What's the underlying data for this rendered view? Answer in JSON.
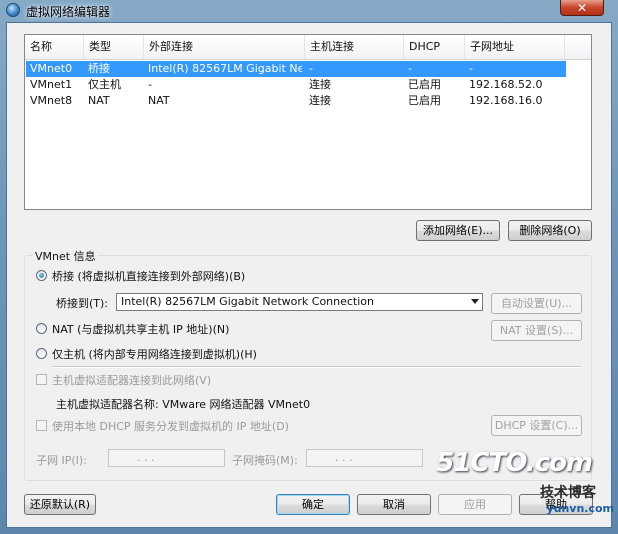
{
  "window": {
    "title": "虚拟网络编辑器",
    "close_glyph": "✕"
  },
  "list": {
    "columns": [
      "名称",
      "类型",
      "外部连接",
      "主机连接",
      "DHCP",
      "子网地址"
    ],
    "rows": [
      [
        "VMnet0",
        "桥接",
        "Intel(R) 82567LM Gigabit Ne...",
        "-",
        "-",
        "-"
      ],
      [
        "VMnet1",
        "仅主机",
        "-",
        "连接",
        "已启用",
        "192.168.52.0"
      ],
      [
        "VMnet8",
        "NAT",
        "NAT",
        "连接",
        "已启用",
        "192.168.16.0"
      ]
    ]
  },
  "buttons": {
    "add_network": "添加网络(E)...",
    "remove_network": "删除网络(O)",
    "auto_settings": "自动设置(U)...",
    "nat_settings": "NAT 设置(S)...",
    "dhcp_settings": "DHCP 设置(C)...",
    "restore_defaults": "还原默认(R)",
    "ok": "确定",
    "cancel": "取消",
    "apply": "应用",
    "help": "帮助"
  },
  "vmnet_info": {
    "title": "VMnet 信息",
    "bridged_label": "桥接 (将虚拟机直接连接到外部网络)(B)",
    "bridged_to_label": "桥接到(T):",
    "bridged_to_value": "Intel(R) 82567LM Gigabit Network Connection",
    "nat_label": "NAT (与虚拟机共享主机 IP 地址)(N)",
    "hostonly_label": "仅主机 (将内部专用网络连接到虚拟机)(H)",
    "connect_adapter_label": "主机虚拟适配器连接到此网络(V)",
    "adapter_name_label": "主机虚拟适配器名称: VMware 网络适配器 VMnet0",
    "use_dhcp_label": "使用本地 DHCP 服务分发到虚拟机的 IP 地址(D)",
    "subnet_ip_label": "子网 IP(I):",
    "subnet_mask_label": "子网掩码(M):",
    "ip_placeholder": ".     .     ."
  },
  "watermark": {
    "line1": "51CTO.com",
    "line2": "技术博客",
    "line3": "yunvn.com"
  }
}
